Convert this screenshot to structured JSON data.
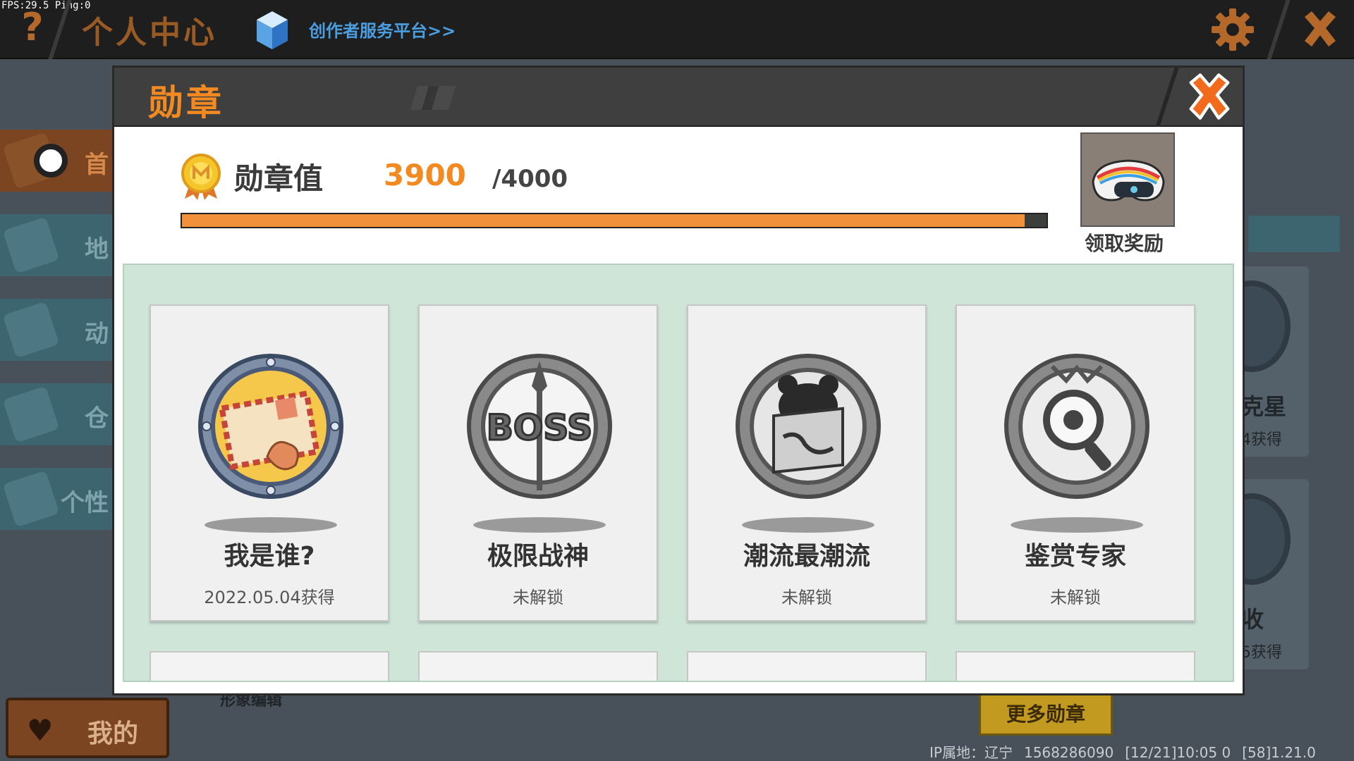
{
  "debug": {
    "fps_text": "FPS:29.5  Ping:0"
  },
  "topbar": {
    "help_glyph": "?",
    "title": "个人中心",
    "creator_link": "创作者服务平台>>",
    "icons": {
      "help": "question-icon",
      "cube": "cube-icon",
      "settings": "gear-icon",
      "close": "close-icon"
    }
  },
  "sidebar": {
    "items": [
      {
        "label": "首",
        "icon": "home-icon",
        "active": true
      },
      {
        "label": "地",
        "icon": "map-icon"
      },
      {
        "label": "动",
        "icon": "bell-icon"
      },
      {
        "label": "仓",
        "icon": "house-icon"
      },
      {
        "label": "个性",
        "icon": "avatar-icon"
      }
    ],
    "mine_label": "我的"
  },
  "background": {
    "avatar_edit_label": "形象编辑",
    "more_medals_label": "更多勋章",
    "right_cards": [
      {
        "title": "克星",
        "subtitle": "4获得"
      },
      {
        "title": "收",
        "subtitle": "5获得"
      }
    ],
    "status_bar": {
      "ip_location": "IP属地：辽宁",
      "uid": "1568286090",
      "time_info": "[12/21]10:05 0",
      "version": "[58]1.21.0"
    }
  },
  "dialog": {
    "title": "勋章",
    "score_label": "勋章值",
    "score_value": "3900",
    "score_max": "/4000",
    "progress_fraction": 0.975,
    "reward_label": "领取奖励",
    "accent_color": "#f28a21",
    "medals": [
      {
        "name": "我是谁?",
        "status": "2022.05.04获得",
        "unlocked": true,
        "icon": "envelope-medal-icon"
      },
      {
        "name": "极限战神",
        "status": "未解锁",
        "unlocked": false,
        "icon": "boss-medal-icon"
      },
      {
        "name": "潮流最潮流",
        "status": "未解锁",
        "unlocked": false,
        "icon": "bear-medal-icon"
      },
      {
        "name": "鉴赏专家",
        "status": "未解锁",
        "unlocked": false,
        "icon": "magnifier-medal-icon"
      }
    ]
  }
}
